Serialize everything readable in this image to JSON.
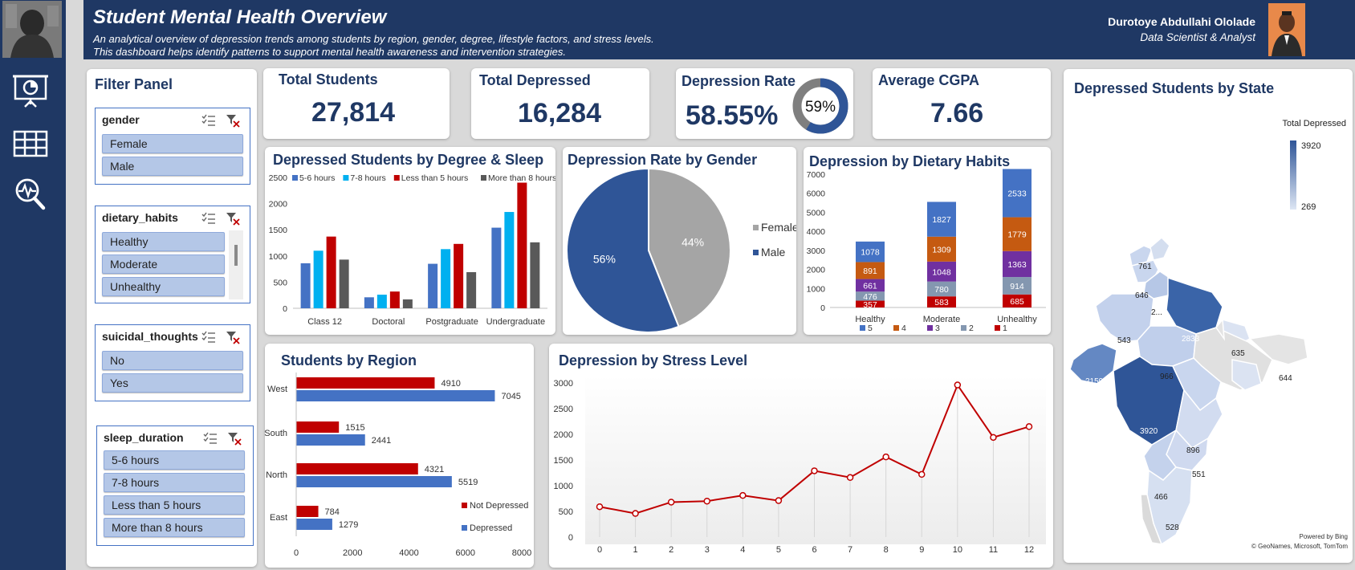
{
  "header": {
    "title": "Student Mental Health Overview",
    "subtitle_line1": "An analytical overview of depression trends among students by region, gender, degree, lifestyle factors, and stress levels.",
    "subtitle_line2": "This dashboard helps identify patterns to support mental health awareness and intervention strategies.",
    "author_name": "Durotoye Abdullahi Ololade",
    "author_role": "Data Scientist & Analyst"
  },
  "sidebar": {
    "items": [
      {
        "icon": "presentation-icon"
      },
      {
        "icon": "table-icon"
      },
      {
        "icon": "search-analytics-icon"
      }
    ]
  },
  "filter_panel": {
    "title": "Filter Panel",
    "slicers": [
      {
        "field": "gender",
        "items": [
          "Female",
          "Male"
        ]
      },
      {
        "field": "dietary_habits",
        "items": [
          "Healthy",
          "Moderate",
          "Unhealthy"
        ]
      },
      {
        "field": "suicidal_thoughts",
        "items": [
          "No",
          "Yes"
        ]
      },
      {
        "field": "sleep_duration",
        "items": [
          "5-6 hours",
          "7-8 hours",
          "Less than 5 hours",
          "More than 8 hours"
        ]
      }
    ]
  },
  "kpis": {
    "total_students": {
      "label": "Total Students",
      "value": "27,814"
    },
    "total_depressed": {
      "label": "Total Depressed",
      "value": "16,284"
    },
    "depression_rate": {
      "label": "Depression Rate",
      "value": "58.55%",
      "donut_label": "59%",
      "fraction": 0.5855
    },
    "average_cgpa": {
      "label": "Average CGPA",
      "value": "7.66"
    }
  },
  "colors": {
    "navy": "#1f3864",
    "blue": "#4472c4",
    "cyan": "#00b0f0",
    "red": "#c00000",
    "gray": "#595959",
    "light_gray": "#a5a5a5",
    "orange": "#c55a11",
    "purple": "#7030a0",
    "slate": "#8497b0"
  },
  "chart_data": [
    {
      "id": "degree_sleep",
      "type": "bar",
      "title": "Depressed Students by Degree & Sleep",
      "categories": [
        "Class 12",
        "Doctoral",
        "Postgraduate",
        "Undergraduate"
      ],
      "series": [
        {
          "name": "5-6 hours",
          "values": [
            860,
            210,
            850,
            1540
          ]
        },
        {
          "name": "7-8 hours",
          "values": [
            1100,
            260,
            1130,
            1840
          ]
        },
        {
          "name": "Less than 5 hours",
          "values": [
            1370,
            320,
            1230,
            2400
          ]
        },
        {
          "name": "More than 8 hours",
          "values": [
            930,
            170,
            690,
            1260
          ]
        }
      ],
      "yticks": [
        "0",
        "500",
        "1000",
        "1500",
        "2000",
        "2500"
      ],
      "ylim": [
        0,
        2500
      ],
      "legend": "top"
    },
    {
      "id": "gender_pie",
      "type": "pie",
      "title": "Depression Rate by Gender",
      "slices": [
        {
          "name": "Female",
          "value": 44,
          "label": "44%"
        },
        {
          "name": "Male",
          "value": 56,
          "label": "56%"
        }
      ],
      "legend": "right"
    },
    {
      "id": "dietary_stacked",
      "type": "bar",
      "title": "Depression by Dietary Habits",
      "categories": [
        "Healthy",
        "Moderate",
        "Unhealthy"
      ],
      "series": [
        {
          "name": "1",
          "values": [
            357,
            583,
            685
          ],
          "labels": [
            "357",
            "583",
            "685"
          ]
        },
        {
          "name": "2",
          "values": [
            476,
            780,
            914
          ],
          "labels": [
            "476",
            "780",
            "914"
          ]
        },
        {
          "name": "3",
          "values": [
            661,
            1048,
            1363
          ],
          "labels": [
            "661",
            "1048",
            "1363"
          ]
        },
        {
          "name": "4",
          "values": [
            891,
            1309,
            1779
          ],
          "labels": [
            "891",
            "1309",
            "1779"
          ]
        },
        {
          "name": "5",
          "values": [
            1078,
            1827,
            2533
          ],
          "labels": [
            "1078",
            "1827",
            "2533"
          ]
        }
      ],
      "legend_order": [
        "5",
        "4",
        "3",
        "2",
        "1"
      ],
      "yticks": [
        "0",
        "1000",
        "2000",
        "3000",
        "4000",
        "5000",
        "6000",
        "7000"
      ],
      "ylim": [
        0,
        7000
      ],
      "stacked": true
    },
    {
      "id": "region_bar",
      "type": "bar",
      "orientation": "horizontal",
      "title": "Students by Region",
      "categories": [
        "West",
        "South",
        "North",
        "East"
      ],
      "series": [
        {
          "name": "Not Depressed",
          "values": [
            4910,
            1515,
            4321,
            784
          ],
          "labels": [
            "4910",
            "1515",
            "4321",
            "784"
          ]
        },
        {
          "name": "Depressed",
          "values": [
            7045,
            2441,
            5519,
            1279
          ],
          "labels": [
            "7045",
            "2441",
            "5519",
            "1279"
          ]
        }
      ],
      "xticks": [
        "0",
        "2000",
        "4000",
        "6000",
        "8000"
      ],
      "xlim": [
        0,
        8000
      ],
      "legend": "bottom-right"
    },
    {
      "id": "stress_line",
      "type": "line",
      "title": "Depression by Stress Level",
      "x": [
        "0",
        "1",
        "2",
        "3",
        "4",
        "5",
        "6",
        "7",
        "8",
        "9",
        "10",
        "11",
        "12"
      ],
      "values": [
        590,
        460,
        680,
        700,
        810,
        710,
        1290,
        1160,
        1560,
        1220,
        2960,
        1940,
        2150
      ],
      "yticks": [
        "0",
        "500",
        "1000",
        "1500",
        "2000",
        "2500",
        "3000"
      ],
      "ylim": [
        0,
        3000
      ]
    },
    {
      "id": "state_map",
      "type": "map",
      "title": "Depressed Students by State",
      "legend_title": "Total Depressed",
      "legend_max": "3920",
      "legend_min": "269",
      "labels": [
        "761",
        "646",
        "2...",
        "543",
        "2833",
        "635",
        "966",
        "2159",
        "644",
        "3920",
        "896",
        "551",
        "466",
        "528"
      ],
      "credit_line1": "Powered by Bing",
      "credit_line2": "© GeoNames, Microsoft, TomTom"
    }
  ]
}
